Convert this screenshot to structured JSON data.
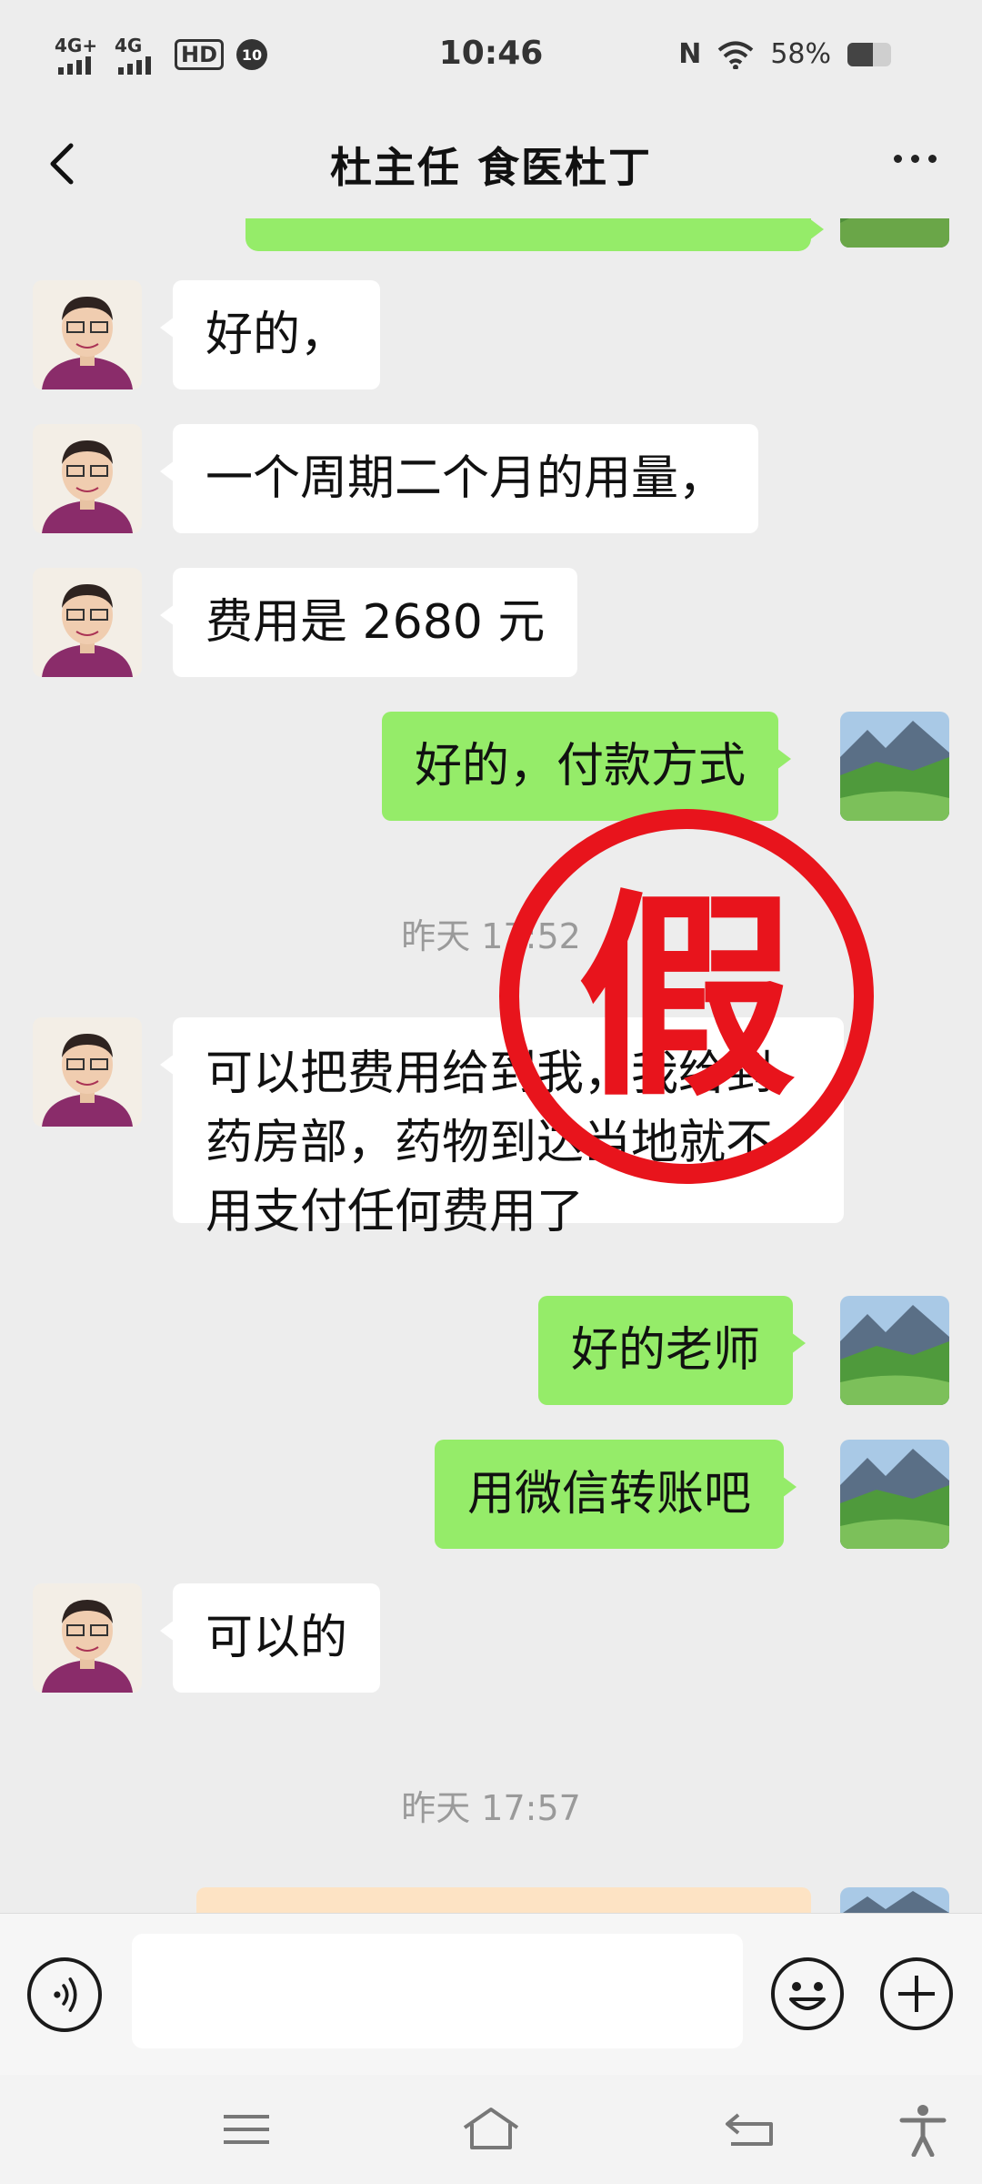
{
  "status_bar": {
    "network1": "4G+",
    "network2": "4G",
    "hd": "HD",
    "notif_badge": "10",
    "time": "10:46",
    "nfc": "N",
    "battery_pct": "58%",
    "battery_level": 0.58
  },
  "header": {
    "title": "杜主任 食医杜丁"
  },
  "messages": [
    {
      "from": "peer",
      "text": "好的，"
    },
    {
      "from": "peer",
      "text": "一个周期二个月的用量，"
    },
    {
      "from": "peer",
      "text": "费用是 2680 元"
    },
    {
      "from": "me",
      "text": "好的，付款方式"
    },
    {
      "type": "time",
      "text": "昨天 17:52"
    },
    {
      "from": "peer",
      "lines": [
        "可以把费用给到我，我给到",
        "药房部，药物到达当地就不",
        "用支付任何费用了"
      ]
    },
    {
      "from": "me",
      "text": "好的老师"
    },
    {
      "from": "me",
      "text": "用微信转账吧"
    },
    {
      "from": "peer",
      "text": "可以的"
    },
    {
      "type": "time",
      "text": "昨天 17:57"
    }
  ],
  "stamp": {
    "text": "假",
    "color": "#e8141c"
  },
  "colors": {
    "outgoing_bubble": "#95ec69",
    "incoming_bubble": "#ffffff",
    "background": "#ededed",
    "transfer_card": "#fde3c4"
  },
  "input_bar": {
    "value": "",
    "icons": [
      "voice-icon",
      "emoji-icon",
      "plus-icon"
    ]
  },
  "system_nav": {
    "icons": [
      "menu-icon",
      "home-icon",
      "back-icon",
      "accessibility-icon"
    ]
  }
}
